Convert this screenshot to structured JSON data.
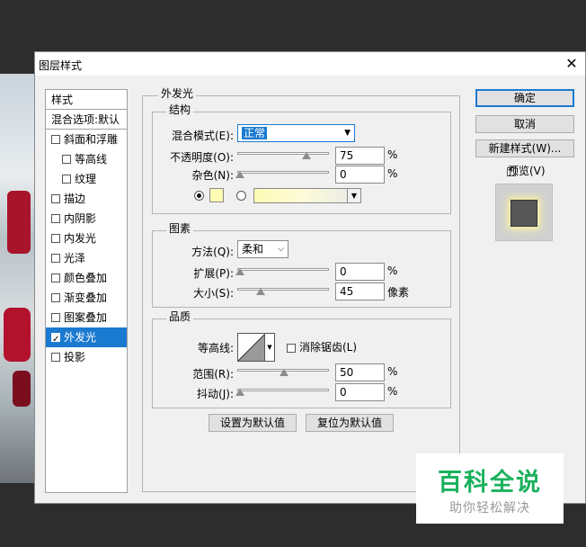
{
  "dialog": {
    "title": "图层样式",
    "close_glyph": "✕"
  },
  "styles_list": {
    "header": "样式",
    "blend_options": "混合选项:默认",
    "items": [
      {
        "label": "斜面和浮雕",
        "checked": false
      },
      {
        "label": "等高线",
        "checked": false,
        "indent": true
      },
      {
        "label": "纹理",
        "checked": false,
        "indent": true
      },
      {
        "label": "描边",
        "checked": false
      },
      {
        "label": "内阴影",
        "checked": false
      },
      {
        "label": "内发光",
        "checked": false
      },
      {
        "label": "光泽",
        "checked": false
      },
      {
        "label": "颜色叠加",
        "checked": false
      },
      {
        "label": "渐变叠加",
        "checked": false
      },
      {
        "label": "图案叠加",
        "checked": false
      },
      {
        "label": "外发光",
        "checked": true,
        "selected": true
      },
      {
        "label": "投影",
        "checked": false
      }
    ]
  },
  "outer_glow": {
    "section_title": "外发光",
    "structure": {
      "title": "结构",
      "blend_mode_label": "混合模式(E):",
      "blend_mode_value": "正常",
      "opacity_label": "不透明度(O):",
      "opacity_value": "75",
      "opacity_unit": "%",
      "noise_label": "杂色(N):",
      "noise_value": "0",
      "noise_unit": "%",
      "glow_color": "#fdfbb4"
    },
    "elements": {
      "title": "图素",
      "technique_label": "方法(Q):",
      "technique_value": "柔和",
      "spread_label": "扩展(P):",
      "spread_value": "0",
      "spread_unit": "%",
      "size_label": "大小(S):",
      "size_value": "45",
      "size_unit": "像素"
    },
    "quality": {
      "title": "品质",
      "contour_label": "等高线:",
      "anti_alias_label": "消除锯齿(L)",
      "range_label": "范围(R):",
      "range_value": "50",
      "range_unit": "%",
      "jitter_label": "抖动(J):",
      "jitter_value": "0",
      "jitter_unit": "%"
    },
    "set_default_label": "设置为默认值",
    "reset_default_label": "复位为默认值"
  },
  "actions": {
    "ok_label": "确定",
    "cancel_label": "取消",
    "new_style_label": "新建样式(W)...",
    "preview_label": "预览(V)",
    "preview_checked": true
  },
  "watermark": {
    "title": "百科全说",
    "subtitle": "助你轻松解决"
  },
  "colors": {
    "accent": "#1a7ad0",
    "watermark_green": "#1bb15d"
  }
}
